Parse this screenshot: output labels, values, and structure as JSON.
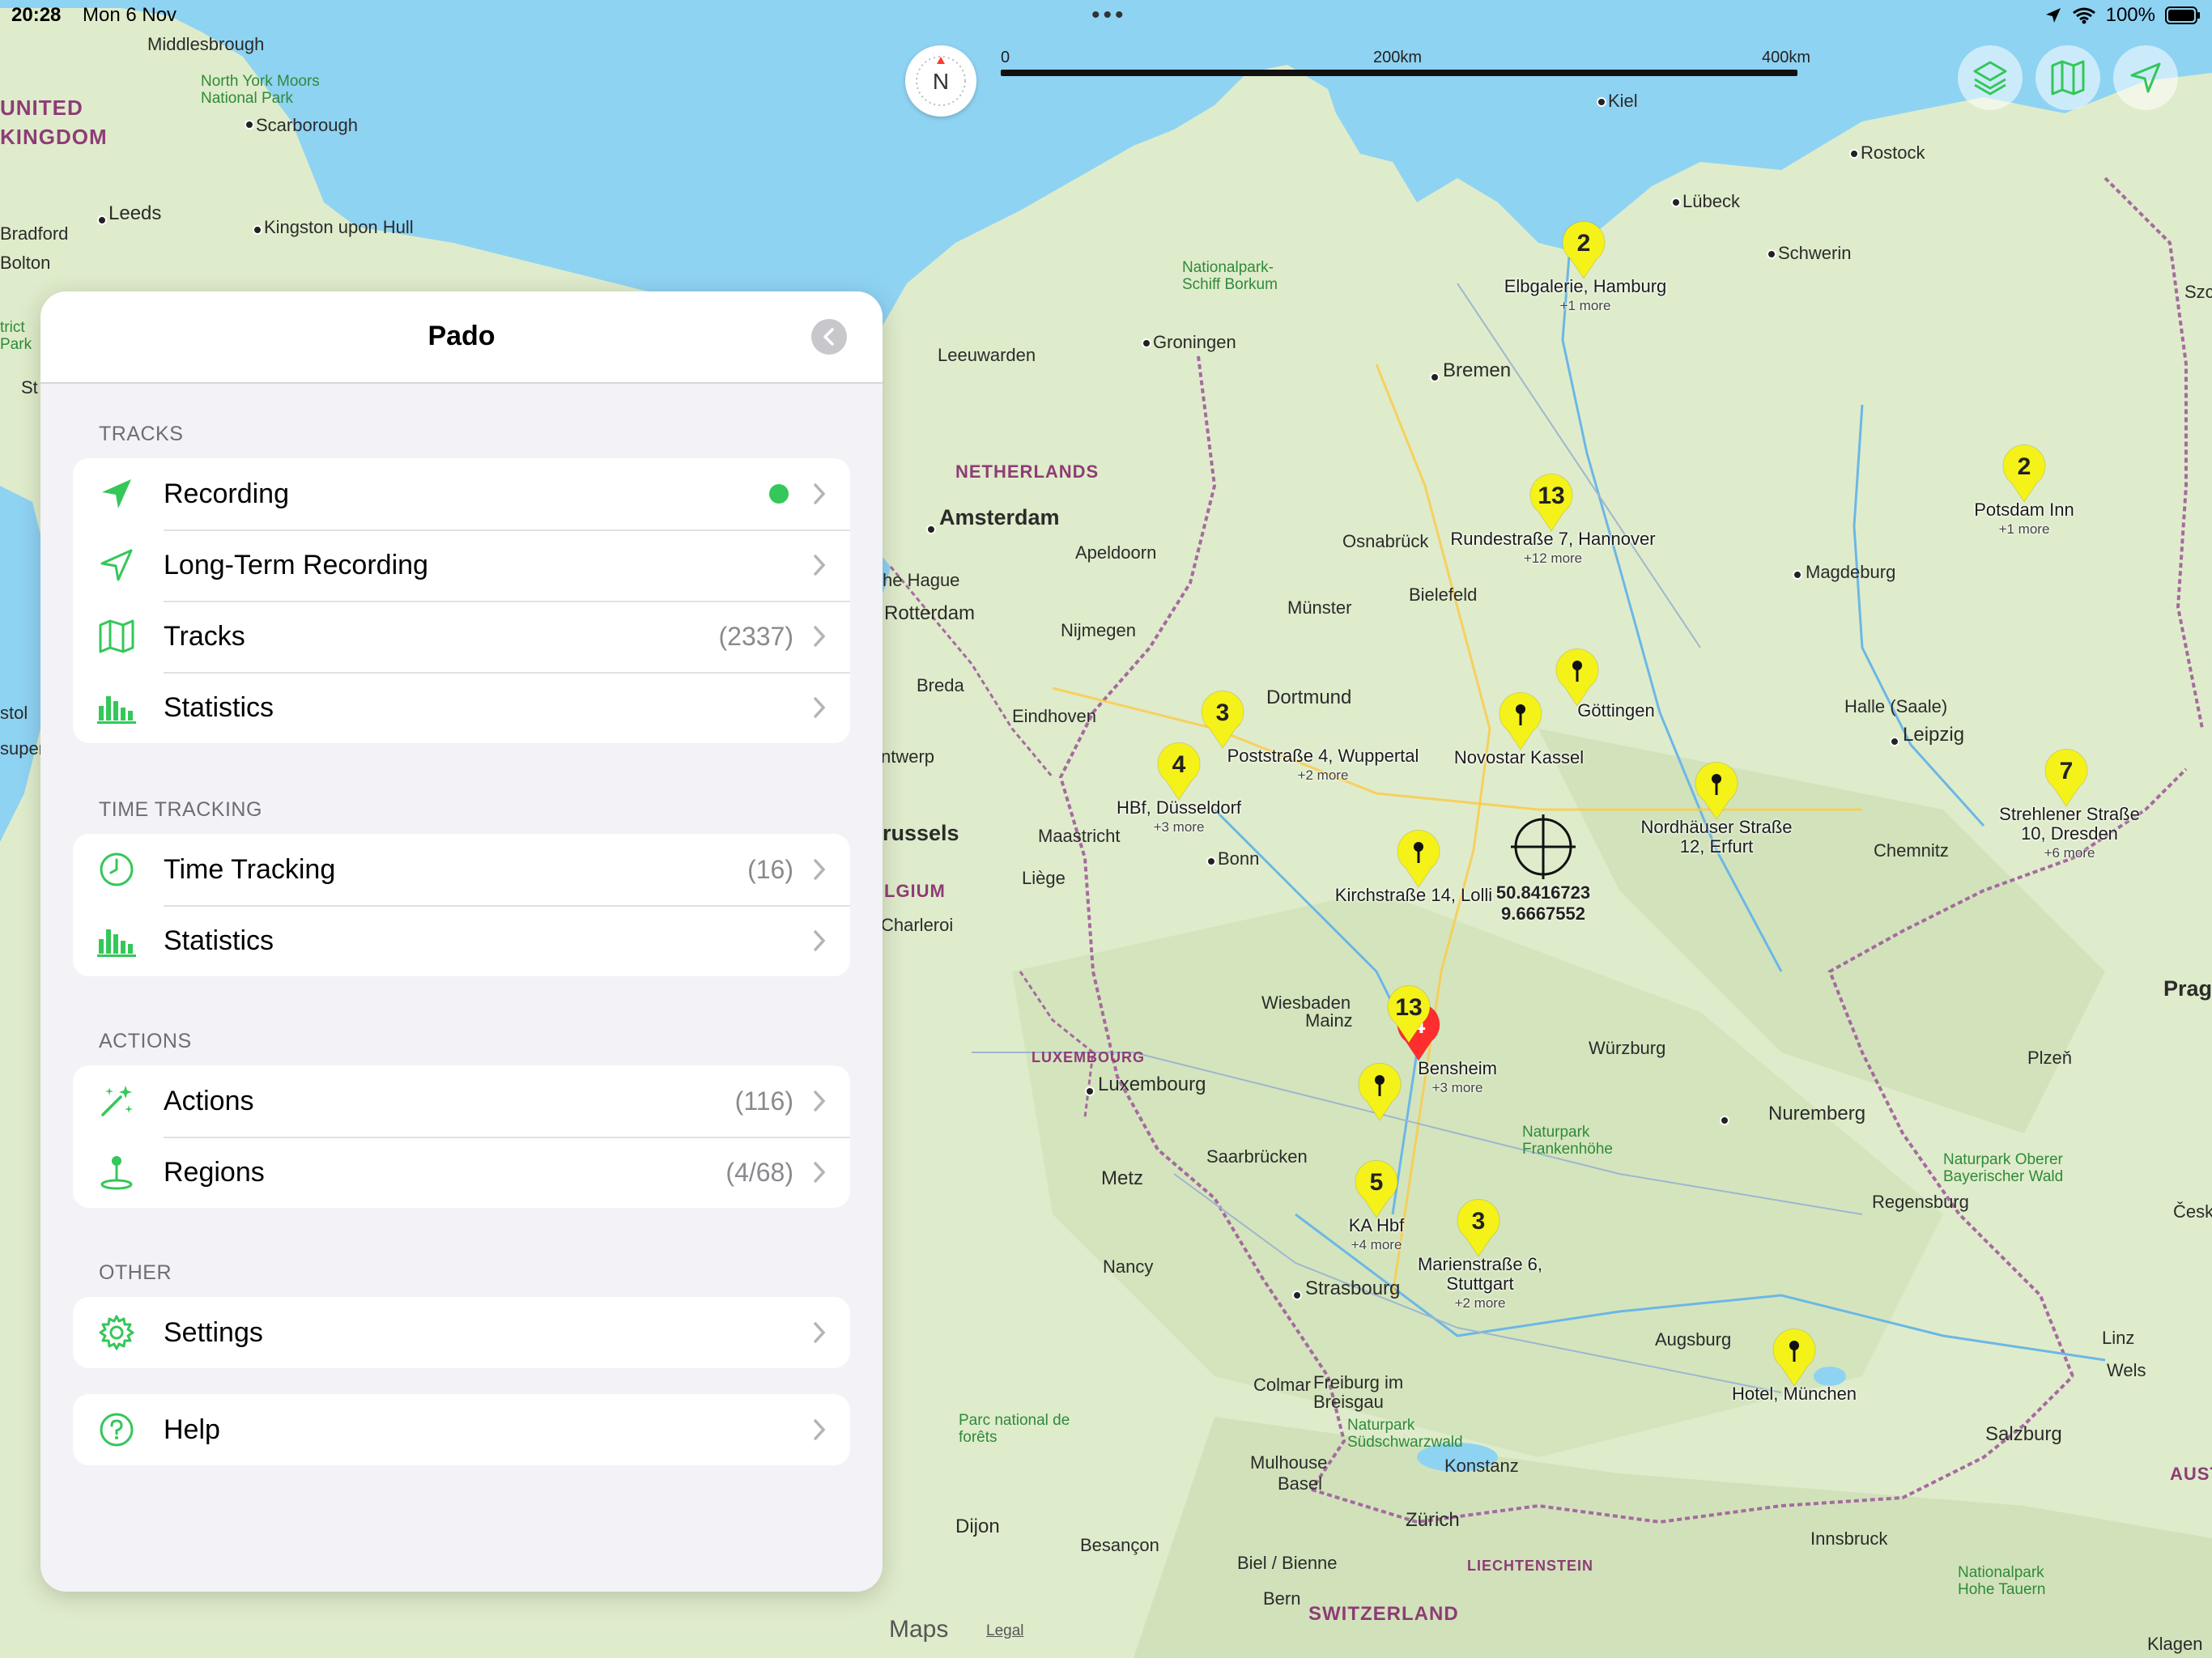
{
  "status_bar": {
    "time": "20:28",
    "date": "Mon 6 Nov",
    "battery": "100%"
  },
  "panel": {
    "title": "Pado",
    "sections": [
      {
        "header": "TRACKS",
        "items": [
          {
            "label": "Recording",
            "count": "",
            "icon": "location-arrow-filled-icon",
            "active": true
          },
          {
            "label": "Long-Term Recording",
            "count": "",
            "icon": "location-arrow-outline-icon"
          },
          {
            "label": "Tracks",
            "count": "(2337)",
            "icon": "map-icon"
          },
          {
            "label": "Statistics",
            "count": "",
            "icon": "bar-chart-icon"
          }
        ]
      },
      {
        "header": "TIME TRACKING",
        "items": [
          {
            "label": "Time Tracking",
            "count": "(16)",
            "icon": "clock-icon"
          },
          {
            "label": "Statistics",
            "count": "",
            "icon": "bar-chart-icon"
          }
        ]
      },
      {
        "header": "ACTIONS",
        "items": [
          {
            "label": "Actions",
            "count": "(116)",
            "icon": "sparkles-icon"
          },
          {
            "label": "Regions",
            "count": "(4/68)",
            "icon": "region-pin-icon"
          }
        ]
      },
      {
        "header": "OTHER",
        "items": [
          {
            "label": "Settings",
            "count": "",
            "icon": "gear-icon"
          }
        ]
      },
      {
        "header": "",
        "items": [
          {
            "label": "Help",
            "count": "",
            "icon": "question-icon"
          }
        ]
      }
    ]
  },
  "map": {
    "compass": "N",
    "scale": {
      "start": "0",
      "mid": "200km",
      "end": "400km"
    },
    "attribution": {
      "logo": "Maps",
      "legal": "Legal"
    },
    "crosshair_coords": {
      "lat": "50.8416723",
      "lon": "9.6667552"
    },
    "colors": {
      "pin_yellow": "#f5f21a",
      "pin_red": "#ff2d2d",
      "accent_green": "#34c759"
    },
    "pins": [
      {
        "count": "2",
        "label": "Elbgalerie, Hamburg",
        "more": "+1 more"
      },
      {
        "count": "13",
        "label": "Rundestraße 7, Hannover",
        "more": "+12 more"
      },
      {
        "count": "2",
        "label": "Potsdam Inn",
        "more": "+1 more"
      },
      {
        "count": "",
        "label": "Göttingen",
        "more": ""
      },
      {
        "count": "",
        "label": "Novostar Kassel",
        "more": ""
      },
      {
        "count": "3",
        "label": "Poststraße 4, Wuppertal",
        "more": "+2 more"
      },
      {
        "count": "4",
        "label": "HBf, Düsseldorf",
        "more": "+3 more"
      },
      {
        "count": "",
        "label": "Nordhäuser Straße 12, Erfurt",
        "more": ""
      },
      {
        "count": "7",
        "label": "Strehlener Straße 10, Dresden",
        "more": "+6 more"
      },
      {
        "count": "",
        "label": "Kirchstraße 14, Lolli",
        "more": ""
      },
      {
        "count": "4",
        "label": "Bensheim",
        "more": "+3 more"
      },
      {
        "count": "13",
        "label": "",
        "more": ""
      },
      {
        "count": "",
        "label": "",
        "more": ""
      },
      {
        "count": "5",
        "label": "KA Hbf",
        "more": "+4 more"
      },
      {
        "count": "3",
        "label": "Marienstraße 6, Stuttgart",
        "more": "+2 more"
      },
      {
        "count": "",
        "label": "Hotel, München",
        "more": ""
      }
    ],
    "places": {
      "countries": [
        "UNITED",
        "KINGDOM",
        "NETHERLANDS",
        "LUXEMBOURG",
        "LGIUM",
        "SWITZERLAND",
        "LIECHTENSTEIN",
        "AUST"
      ],
      "cities": [
        "Middlesbrough",
        "Scarborough",
        "Leeds",
        "Bradford",
        "Bolton",
        "Kingston upon Hull",
        "Kiel",
        "Rostock",
        "Lübeck",
        "Schwerin",
        "Szc",
        "Groningen",
        "Leeuwarden",
        "Bremen",
        "Amsterdam",
        "Apeldoorn",
        "Osnabrück",
        "he Hague",
        "Rotterdam",
        "Nijmegen",
        "Münster",
        "Bielefeld",
        "Magdeburg",
        "Dortmund",
        "Breda",
        "Eindhoven",
        "ntwerp",
        "Halle (Saale)",
        "Leipzig",
        "russels",
        "Maastricht",
        "Bonn",
        "Liège",
        "Charleroi",
        "Chemnitz",
        "Prag",
        "Wiesbaden",
        "Mainz",
        "Würzburg",
        "Luxembourg",
        "Plzeň",
        "Nuremberg",
        "Saarbrücken",
        "Metz",
        "Regensburg",
        "Česk",
        "Nancy",
        "Strasbourg",
        "Augsburg",
        "Linz",
        "Wels",
        "Colmar",
        "Freiburg im Breisgau",
        "Salzburg",
        "Mulhouse",
        "Basel",
        "Konstanz",
        "Zürich",
        "Dijon",
        "Besançon",
        "Biel / Bienne",
        "Innsbruck",
        "Bern",
        "Klagen",
        "stol",
        "super",
        "St"
      ],
      "parks": [
        "North York Moors National Park",
        "Nationalpark-Schiff Borkum",
        "Naturpark Frankenhöhe",
        "Naturpark Oberer Bayerischer Wald",
        "Parc national de forêts",
        "Naturpark Südschwarzwald",
        "Nationalpark Hohe Tauern",
        "trict Park"
      ]
    }
  }
}
